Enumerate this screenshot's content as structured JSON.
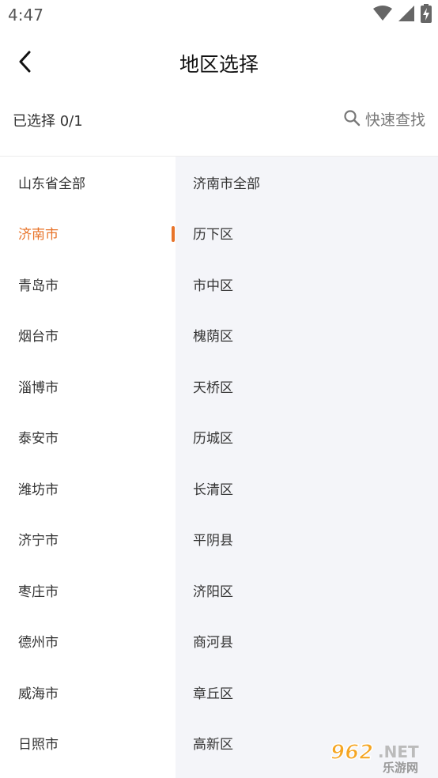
{
  "status_bar": {
    "time": "4:47"
  },
  "header": {
    "title": "地区选择"
  },
  "selection": {
    "count_label": "已选择 0/1",
    "search_label": "快速查找"
  },
  "provinces": [
    {
      "label": "山东省全部"
    },
    {
      "label": "济南市"
    },
    {
      "label": "青岛市"
    },
    {
      "label": "烟台市"
    },
    {
      "label": "淄博市"
    },
    {
      "label": "泰安市"
    },
    {
      "label": "潍坊市"
    },
    {
      "label": "济宁市"
    },
    {
      "label": "枣庄市"
    },
    {
      "label": "德州市"
    },
    {
      "label": "威海市"
    },
    {
      "label": "日照市"
    }
  ],
  "active_city_index": 1,
  "districts": [
    {
      "label": "济南市全部"
    },
    {
      "label": "历下区"
    },
    {
      "label": "市中区"
    },
    {
      "label": "槐荫区"
    },
    {
      "label": "天桥区"
    },
    {
      "label": "历城区"
    },
    {
      "label": "长清区"
    },
    {
      "label": "平阴县"
    },
    {
      "label": "济阳区"
    },
    {
      "label": "商河县"
    },
    {
      "label": "章丘区"
    },
    {
      "label": "高新区"
    }
  ],
  "watermark": {
    "number": "962",
    "tld": ".NET",
    "site": "乐游网"
  },
  "colors": {
    "accent": "#e8742a",
    "right_panel_bg": "#f4f5f9"
  }
}
